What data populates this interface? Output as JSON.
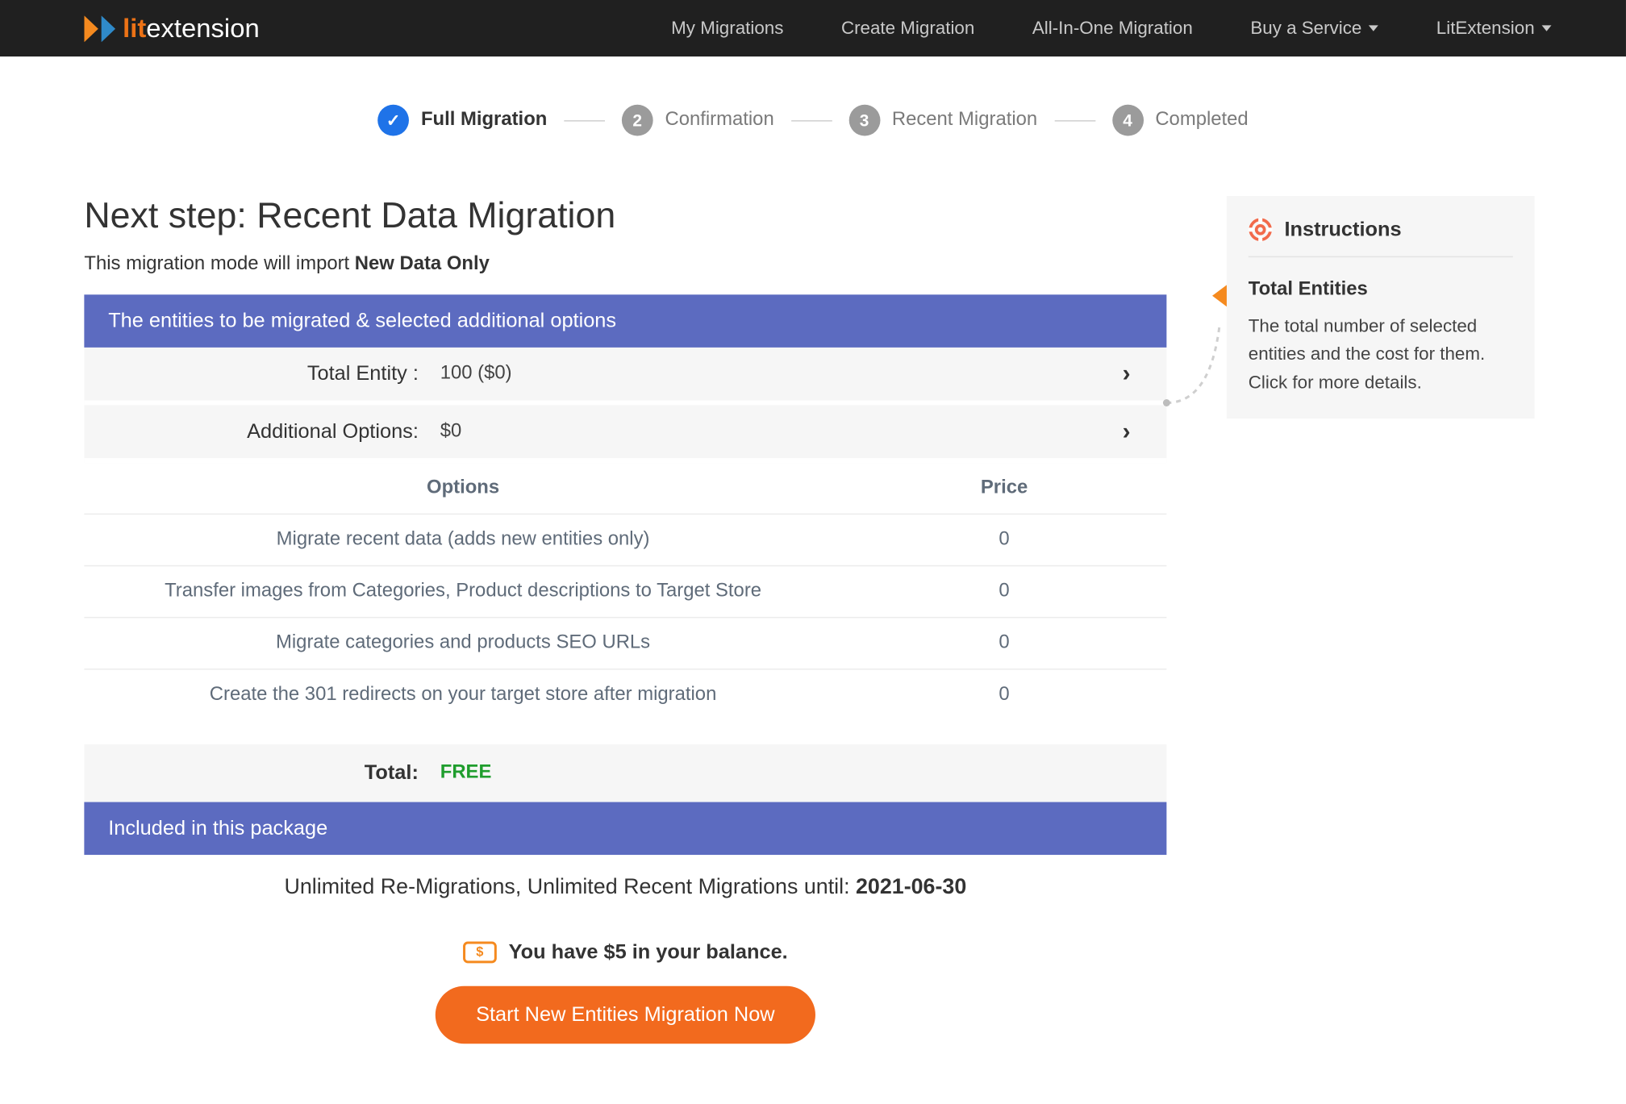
{
  "header": {
    "logo_lit": "lit",
    "logo_ext": "extension",
    "nav": [
      {
        "label": "My Migrations"
      },
      {
        "label": "Create Migration"
      },
      {
        "label": "All-In-One Migration"
      },
      {
        "label": "Buy a Service",
        "dropdown": true
      },
      {
        "label": "LitExtension",
        "dropdown": true
      }
    ]
  },
  "stepper": {
    "steps": [
      {
        "label": "Full Migration",
        "active": true,
        "done": true
      },
      {
        "num": "2",
        "label": "Confirmation"
      },
      {
        "num": "3",
        "label": "Recent Migration"
      },
      {
        "num": "4",
        "label": "Completed"
      }
    ]
  },
  "page": {
    "title": "Next step: Recent Data Migration",
    "subtitle_prefix": "This migration mode will import ",
    "subtitle_bold": "New Data Only"
  },
  "entities_header": "The entities to be migrated & selected additional options",
  "total_entity": {
    "label": "Total Entity :",
    "value": "100 ($0)"
  },
  "add_options": {
    "label": "Additional Options:",
    "value": "$0"
  },
  "option_headers": {
    "options": "Options",
    "price": "Price"
  },
  "option_rows": [
    {
      "options": "Migrate recent data (adds new entities only)",
      "price": "0"
    },
    {
      "options": "Transfer images from Categories, Product descriptions to Target Store",
      "price": "0"
    },
    {
      "options": "Migrate categories and products SEO URLs",
      "price": "0"
    },
    {
      "options": "Create the 301 redirects on your target store after migration",
      "price": "0"
    }
  ],
  "total": {
    "label": "Total:",
    "value": "FREE"
  },
  "package_header": "Included in this package",
  "package_line_prefix": "Unlimited Re-Migrations, Unlimited Recent Migrations until: ",
  "package_line_bold": "2021-06-30",
  "balance_line": "You have $5 in your balance.",
  "cta_label": "Start New Entities Migration Now",
  "instructions": {
    "heading": "Instructions",
    "sub": "Total Entities",
    "text": "The total number of selected entities and the cost for them. Click for more details."
  }
}
